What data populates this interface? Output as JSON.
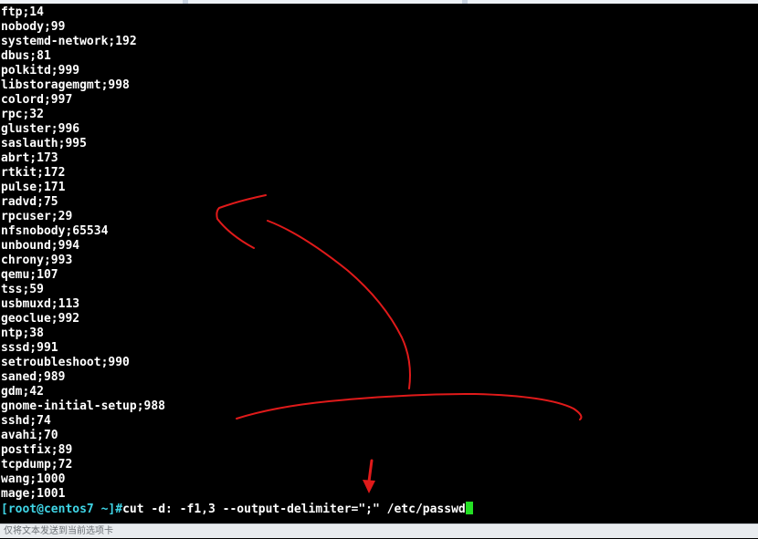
{
  "terminal": {
    "lines": [
      "ftp;14",
      "nobody;99",
      "systemd-network;192",
      "dbus;81",
      "polkitd;999",
      "libstoragemgmt;998",
      "colord;997",
      "rpc;32",
      "gluster;996",
      "saslauth;995",
      "abrt;173",
      "rtkit;172",
      "pulse;171",
      "radvd;75",
      "rpcuser;29",
      "nfsnobody;65534",
      "unbound;994",
      "chrony;993",
      "qemu;107",
      "tss;59",
      "usbmuxd;113",
      "geoclue;992",
      "ntp;38",
      "sssd;991",
      "setroubleshoot;990",
      "saned;989",
      "gdm;42",
      "gnome-initial-setup;988",
      "sshd;74",
      "avahi;70",
      "postfix;89",
      "tcpdump;72",
      "wang;1000",
      "mage;1001"
    ],
    "prompt": "[root@centos7 ~]#",
    "command": "cut -d: -f1,3 --output-delimiter=\";\" /etc/passwd"
  },
  "statusbar": {
    "text": "仅将文本发送到当前选项卡"
  },
  "colors": {
    "background": "#000000",
    "text": "#ffffff",
    "prompt": "#3fd5e6",
    "cursor": "#24e024",
    "annotation": "#e01a1a"
  }
}
